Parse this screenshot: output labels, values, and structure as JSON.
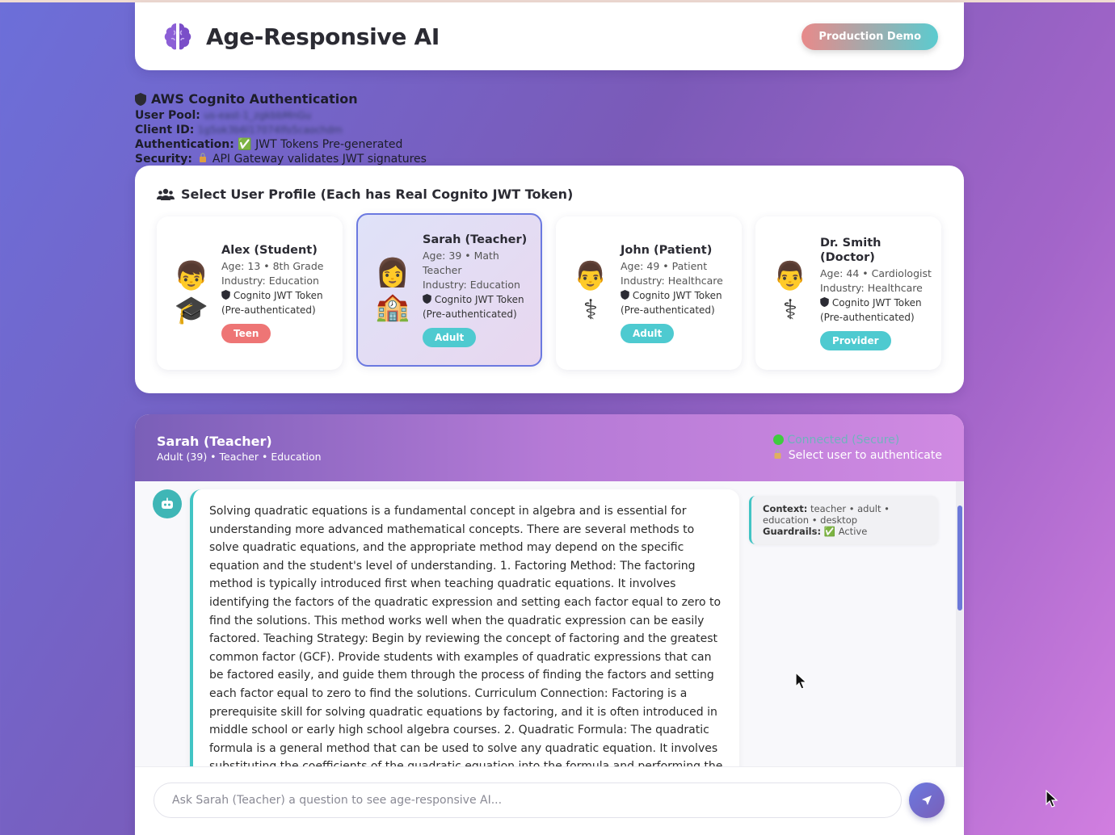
{
  "app": {
    "title": "Age-Responsive AI",
    "badge": "Production Demo"
  },
  "auth": {
    "title": "AWS Cognito Authentication",
    "user_pool_label": "User Pool:",
    "user_pool_value": "us-east-1_zgkbbMnGu",
    "client_id_label": "Client ID:",
    "client_id_value": "1g5ok3b6l17074lfo5caochdm",
    "authentication_label": "Authentication:",
    "authentication_value": "✅ JWT Tokens Pre-generated",
    "security_label": "Security:",
    "security_value": "API Gateway validates JWT signatures"
  },
  "profiles": {
    "title": "Select User Profile (Each has Real Cognito JWT Token)",
    "cards": [
      {
        "name": "Alex (Student)",
        "line1": "Age: 13 • 8th Grade",
        "line2": "Industry: Education",
        "token": "Cognito JWT Token",
        "token_note": "(Pre-authenticated)",
        "badge": "Teen",
        "avatar": "👦",
        "emblem": "🎓"
      },
      {
        "name": "Sarah (Teacher)",
        "line1": "Age: 39 • Math",
        "line1b": "Teacher",
        "line2": "Industry: Education",
        "token": "Cognito JWT Token",
        "token_note": "(Pre-authenticated)",
        "badge": "Adult",
        "avatar": "👩",
        "emblem": "🏫"
      },
      {
        "name": "John (Patient)",
        "line1": "Age: 49 • Patient",
        "line2": "Industry: Healthcare",
        "token": "Cognito JWT Token",
        "token_note": "(Pre-authenticated)",
        "badge": "Adult",
        "avatar": "👨",
        "emblem": "⚕"
      },
      {
        "name": "Dr. Smith",
        "name2": "(Doctor)",
        "line1": "Age: 44 • Cardiologist",
        "line2": "Industry: Healthcare",
        "token": "Cognito JWT Token",
        "token_note": "(Pre-authenticated)",
        "badge": "Provider",
        "avatar": "👨",
        "emblem": "⚕"
      }
    ]
  },
  "chat": {
    "name": "Sarah (Teacher)",
    "subtitle": "Adult (39) • Teacher • Education",
    "status_connected": "Connected (Secure)",
    "status_auth": "Select user to authenticate",
    "message": "Solving quadratic equations is a fundamental concept in algebra and is essential for understanding more advanced mathematical concepts. There are several methods to solve quadratic equations, and the appropriate method may depend on the specific equation and the student's level of understanding. 1. Factoring Method: The factoring method is typically introduced first when teaching quadratic equations. It involves identifying the factors of the quadratic expression and setting each factor equal to zero to find the solutions. This method works well when the quadratic expression can be easily factored. Teaching Strategy: Begin by reviewing the concept of factoring and the greatest common factor (GCF). Provide students with examples of quadratic expressions that can be factored easily, and guide them through the process of finding the factors and setting each factor equal to zero to find the solutions. Curriculum Connection: Factoring is a prerequisite skill for solving quadratic equations by factoring, and it is often introduced in middle school or early high school algebra courses. 2. Quadratic Formula: The quadratic formula is a general method that can be used to solve any quadratic equation. It involves substituting the coefficients of the quadratic equation into the formula and performing the necessary calculations. Teaching Strategy: Introduce the quadratic formula and explain the meaning of each term (a, b, c). Provide step-by-step examples of how to",
    "context_label": "Context:",
    "context_value": "teacher • adult • education • desktop",
    "guardrails_label": "Guardrails:",
    "guardrails_value": "✅ Active",
    "input_placeholder": "Ask Sarah (Teacher) a question to see age-responsive AI...",
    "input_value": ""
  },
  "colors": {
    "accent": "#6b79e0",
    "teal": "#41c4c4",
    "teen": "#ee7575",
    "adult": "#4ecad0"
  }
}
